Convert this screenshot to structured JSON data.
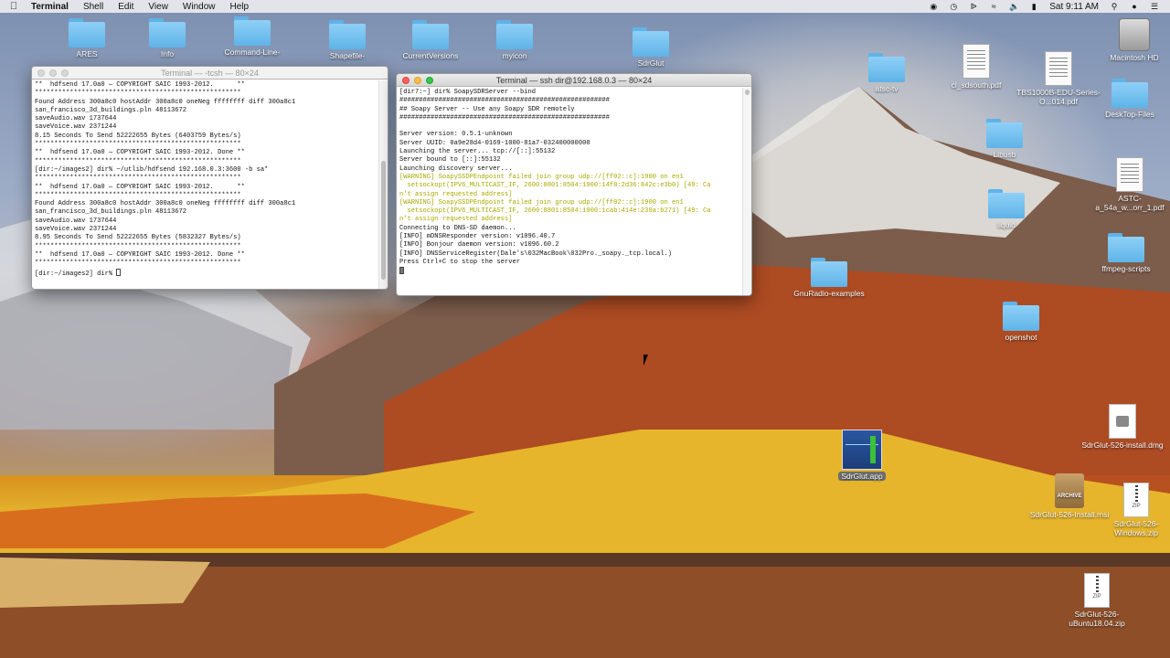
{
  "menubar": {
    "app_name": "Terminal",
    "menus": [
      "Shell",
      "Edit",
      "View",
      "Window",
      "Help"
    ],
    "clock": "Sat 9:11 AM"
  },
  "desktop_icons": {
    "ares": "ARES",
    "info": "Info",
    "command_line": "Command-Line-",
    "shapefile": "Shapefile-",
    "current_versions": "CurrentVersions",
    "myicon": "myicon",
    "sdrglut": "SdrGlut",
    "atsc_tv": "atsc-tv",
    "cl_sdsouth": "cl_sdsouth.pdf",
    "tbs": "TBS1000B-EDU-Series-O...014.pdf",
    "macintosh_hd": "Macintosh HD",
    "desktop_files": "DeskTop-Files",
    "libusb": "Libusb",
    "astc": "ASTC-a_54a_w...orr_1.pdf",
    "liquid": "liquid",
    "ffmpeg": "ffmpeg-scripts",
    "gnuradio": "GnuRadio-examples",
    "openshot": "openshot",
    "sdrglut_app": "SdrGlut.app",
    "install_dmg": "SdrGlut-526-install.dmg",
    "install_msi": "SdrGlut-526-Install.msi",
    "windows_zip": "SdrGlut-526-Windows.zip",
    "ubuntu_zip": "SdrGlut-526-uBuntu18.04.zip",
    "archive_label": "ARCHIVE",
    "zip_label": "ZIP"
  },
  "terminal_left": {
    "title": "Terminal — -tcsh — 80×24",
    "lines": [
      "**  hdfsend 17.0a0 — COPYRIGHT SAIC 1993-2012.      **",
      "*****************************************************",
      "Found Address 300a8c0 hostAddr 300a8c0 oneNeg ffffffff diff 300a8c1",
      "san_francisco_3d_buildings.pln 48113672",
      "saveAudio.wav 1737644",
      "saveVoice.wav 2371244",
      "8.15 Seconds To Send 52222655 Bytes (6403759 Bytes/s)",
      "*****************************************************",
      "**  hdfsend 17.0a0 — COPYRIGHT SAIC 1993-2012. Done **",
      "*****************************************************",
      "[dir:~/images2] dir% ~/utlib/hdfsend 192.168.0.3:3600 -b sa*",
      "*****************************************************",
      "**  hdfsend 17.0a0 — COPYRIGHT SAIC 1993-2012.      **",
      "*****************************************************",
      "Found Address 300a8c0 hostAddr 300a8c0 oneNeg ffffffff diff 300a8c1",
      "san_francisco_3d_buildings.pln 48113672",
      "saveAudio.wav 1737644",
      "saveVoice.wav 2371244",
      "8.95 Seconds To Send 52222655 Bytes (5832327 Bytes/s)",
      "*****************************************************",
      "**  hdfsend 17.0a0 — COPYRIGHT SAIC 1993-2012. Done **",
      "*****************************************************"
    ],
    "prompt": "[dir:~/images2] dir% "
  },
  "terminal_right": {
    "title": "Terminal — ssh dir@192.168.0.3 — 80×24",
    "lines": [
      {
        "t": "[dir7:~] dir% SoapySDRServer --bind",
        "w": false
      },
      {
        "t": "######################################################",
        "w": false
      },
      {
        "t": "## Soapy Server -- Use any Soapy SDR remotely",
        "w": false
      },
      {
        "t": "######################################################",
        "w": false
      },
      {
        "t": "",
        "w": false
      },
      {
        "t": "Server version: 0.5.1-unknown",
        "w": false
      },
      {
        "t": "Server UUID: 0a9e28d4-0169-1000-81a7-032400000000",
        "w": false
      },
      {
        "t": "Launching the server... tcp://[::]:55132",
        "w": false
      },
      {
        "t": "Server bound to [::]:55132",
        "w": false
      },
      {
        "t": "Launching discovery server...",
        "w": false
      },
      {
        "t": "[WARNING] SoapySSDPEndpoint failed join group udp://[ff02::c]:1900 on en1",
        "w": true
      },
      {
        "t": "  setsockopt(IPV6_MULTICAST_IF, 2600:8801:8504:1900:14f8:2d36:842c:e3b0) [49: Ca",
        "w": true
      },
      {
        "t": "n't assign requested address]",
        "w": true
      },
      {
        "t": "[WARNING] SoapySSDPEndpoint failed join group udp://[ff02::c]:1900 on en1",
        "w": true
      },
      {
        "t": "  setsockopt(IPV6_MULTICAST_IF, 2600:8801:8504:1900:1cab:414e:230a:b271) [49: Ca",
        "w": true
      },
      {
        "t": "n't assign requested address]",
        "w": true
      },
      {
        "t": "Connecting to DNS-SD daemon...",
        "w": false
      },
      {
        "t": "[INFO] mDNSResponder version: v1096.40.7",
        "w": false
      },
      {
        "t": "[INFO] Bonjour daemon version: v1096.60.2",
        "w": false
      },
      {
        "t": "[INFO] DNSServiceRegister(Dale's\\032MacBook\\032Pro._soapy._tcp.local.)",
        "w": false
      },
      {
        "t": "Press Ctrl+C to stop the server",
        "w": false
      }
    ]
  }
}
